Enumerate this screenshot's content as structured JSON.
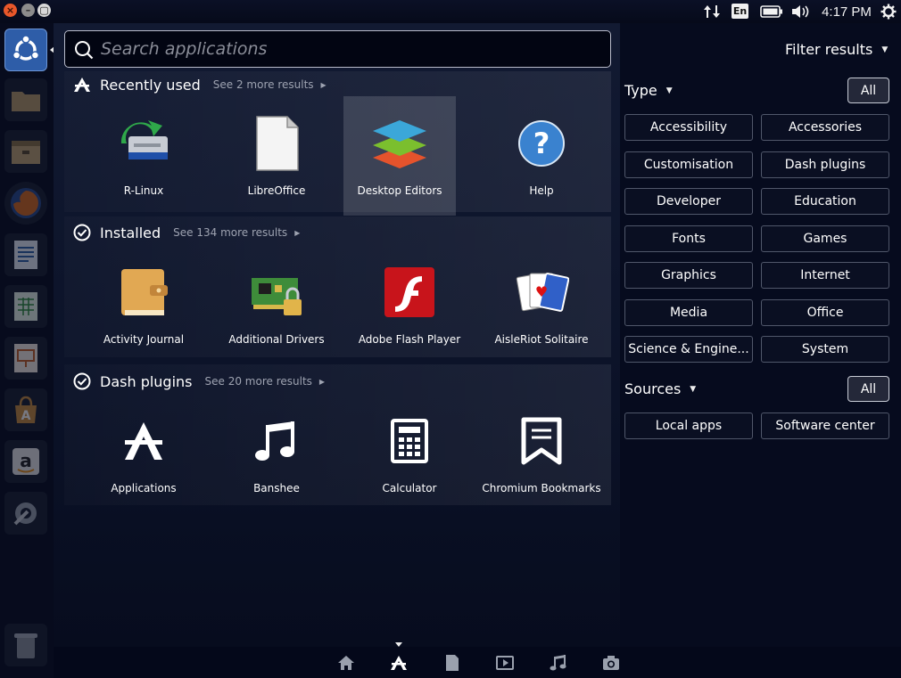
{
  "top_panel": {
    "window_buttons": {
      "close": "×",
      "minimize": "–",
      "maximize": "▢"
    },
    "keyboard_layout": "En",
    "clock": "4:17 PM",
    "icons": [
      "network-updown-icon",
      "keyboard-layout-icon",
      "battery-icon",
      "volume-icon",
      "session-gear-icon"
    ]
  },
  "launcher": {
    "items": [
      {
        "name": "ubuntu-dash",
        "icon": "ubuntu-logo-icon",
        "active": true
      },
      {
        "name": "file-manager",
        "icon": "files-icon"
      },
      {
        "name": "archive",
        "icon": "archive-icon"
      },
      {
        "name": "firefox",
        "icon": "firefox-icon"
      },
      {
        "name": "writer",
        "icon": "writer-icon"
      },
      {
        "name": "calc",
        "icon": "calc-icon"
      },
      {
        "name": "impress",
        "icon": "impress-icon"
      },
      {
        "name": "software-center",
        "icon": "software-center-icon"
      },
      {
        "name": "amazon",
        "icon": "amazon-icon"
      },
      {
        "name": "system-settings",
        "icon": "settings-icon"
      },
      {
        "name": "trash",
        "icon": "trash-icon"
      }
    ]
  },
  "search": {
    "placeholder": "Search applications",
    "value": ""
  },
  "categories": [
    {
      "title": "Recently used",
      "more": "See 2 more results",
      "apps": [
        {
          "label": "R-Linux",
          "icon": "r-linux-icon"
        },
        {
          "label": "LibreOffice",
          "icon": "libreoffice-icon"
        },
        {
          "label": "Desktop Editors",
          "icon": "onlyoffice-icon",
          "hover": true
        },
        {
          "label": "Help",
          "icon": "help-icon"
        }
      ]
    },
    {
      "title": "Installed",
      "more": "See 134 more results",
      "apps": [
        {
          "label": "Activity Journal",
          "icon": "journal-icon"
        },
        {
          "label": "Additional Drivers",
          "icon": "drivers-icon"
        },
        {
          "label": "Adobe Flash Player",
          "icon": "flash-icon"
        },
        {
          "label": "AisleRiot Solitaire",
          "icon": "cards-icon"
        }
      ]
    },
    {
      "title": "Dash plugins",
      "more": "See 20 more results",
      "apps": [
        {
          "label": "Applications",
          "icon": "applications-lens-icon"
        },
        {
          "label": "Banshee",
          "icon": "music-note-icon"
        },
        {
          "label": "Calculator",
          "icon": "calculator-icon"
        },
        {
          "label": "Chromium Bookmarks",
          "icon": "bookmark-icon"
        }
      ]
    }
  ],
  "filters": {
    "title": "Filter results",
    "type": {
      "title": "Type",
      "all_label": "All",
      "options": [
        "Accessibility",
        "Accessories",
        "Customisation",
        "Dash plugins",
        "Developer",
        "Education",
        "Fonts",
        "Games",
        "Graphics",
        "Internet",
        "Media",
        "Office",
        "Science & Engine...",
        "System"
      ]
    },
    "sources": {
      "title": "Sources",
      "all_label": "All",
      "options": [
        "Local apps",
        "Software center"
      ]
    }
  },
  "lens_bar": {
    "items": [
      "home-icon",
      "applications-icon",
      "files-icon",
      "video-icon",
      "music-icon",
      "photo-icon"
    ],
    "active_index": 1
  },
  "colors": {
    "accent": "#2e5da8",
    "background": "#050a1c",
    "close": "#e8572a"
  }
}
